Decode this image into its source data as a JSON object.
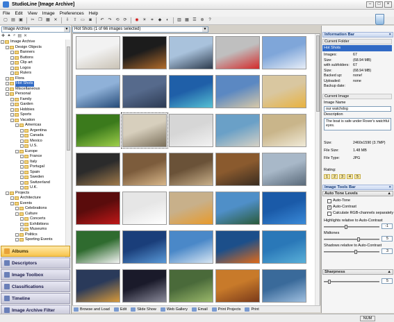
{
  "window": {
    "title": "StudioLine [Image Archive]"
  },
  "menu": [
    "File",
    "Edit",
    "View",
    "Image",
    "Preferences",
    "Help"
  ],
  "left": {
    "combo_value": "Image Archive",
    "tree": [
      {
        "label": "Image Archive",
        "indent": 0
      },
      {
        "label": "Design Objects",
        "indent": 1
      },
      {
        "label": "Banners",
        "indent": 2
      },
      {
        "label": "Buttons",
        "indent": 2
      },
      {
        "label": "Clip art",
        "indent": 2
      },
      {
        "label": "Logos",
        "indent": 2
      },
      {
        "label": "Rulers",
        "indent": 2
      },
      {
        "label": "Flora",
        "indent": 1
      },
      {
        "label": "Hot Shots",
        "indent": 1,
        "selected": true
      },
      {
        "label": "Miscellaneous",
        "indent": 1
      },
      {
        "label": "Personal",
        "indent": 1
      },
      {
        "label": "Family",
        "indent": 2
      },
      {
        "label": "Garden",
        "indent": 2
      },
      {
        "label": "Hobbies",
        "indent": 2
      },
      {
        "label": "Sports",
        "indent": 2
      },
      {
        "label": "Vacation",
        "indent": 2
      },
      {
        "label": "Americas",
        "indent": 3
      },
      {
        "label": "Argentina",
        "indent": 4
      },
      {
        "label": "Canada",
        "indent": 4
      },
      {
        "label": "Mexico",
        "indent": 4
      },
      {
        "label": "U.S.",
        "indent": 4
      },
      {
        "label": "Europe",
        "indent": 3
      },
      {
        "label": "France",
        "indent": 4
      },
      {
        "label": "Italy",
        "indent": 4
      },
      {
        "label": "Portugal",
        "indent": 4
      },
      {
        "label": "Spain",
        "indent": 4
      },
      {
        "label": "Sweden",
        "indent": 4
      },
      {
        "label": "Switzerland",
        "indent": 4
      },
      {
        "label": "U.K.",
        "indent": 4
      },
      {
        "label": "Projects",
        "indent": 1
      },
      {
        "label": "Architecture",
        "indent": 2
      },
      {
        "label": "Events",
        "indent": 2
      },
      {
        "label": "Celebrations",
        "indent": 3
      },
      {
        "label": "Culture",
        "indent": 3
      },
      {
        "label": "Concerts",
        "indent": 4
      },
      {
        "label": "Exhibitions",
        "indent": 4
      },
      {
        "label": "Museums",
        "indent": 4
      },
      {
        "label": "Politics",
        "indent": 3
      },
      {
        "label": "Sporting Events",
        "indent": 3
      }
    ],
    "panels": [
      "Albums",
      "Descriptors",
      "Image Toolbox",
      "Classifications",
      "Timeline",
      "Image Archive Filter"
    ]
  },
  "center": {
    "combo_value": "Hot Shots (1 of 66 images selected)",
    "thumbnails": [
      {
        "c1": "#f2f2f2",
        "c2": "#c9c2b5"
      },
      {
        "c1": "#1c1c1c",
        "c2": "#b26b2a"
      },
      {
        "c1": "#a9c2dc",
        "c2": "#2d3b4d"
      },
      {
        "c1": "#bfbfbf",
        "c2": "#d42a2a"
      },
      {
        "c1": "#7fa6d9",
        "c2": "#e8eef8"
      },
      {
        "c1": "#8fb1d8",
        "c2": "#264b78"
      },
      {
        "c1": "#566a8c",
        "c2": "#2c3a52"
      },
      {
        "c1": "#1f5fa8",
        "c2": "#56c1d3"
      },
      {
        "c1": "#5b88c2",
        "c2": "#d8c9a8"
      },
      {
        "c1": "#d9c7a0",
        "c2": "#e8b23f"
      },
      {
        "c1": "#3b7a1c",
        "c2": "#9fcf4a"
      },
      {
        "c1": "#d7cfbd",
        "c2": "#7a6f5a"
      },
      {
        "c1": "#d6d6d6",
        "c2": "#f2f2f2"
      },
      {
        "c1": "#6aa0c7",
        "c2": "#d6d1c5"
      },
      {
        "c1": "#c9b58a",
        "c2": "#f0ead8"
      },
      {
        "c1": "#2b2b2b",
        "c2": "#a07a4a"
      },
      {
        "c1": "#7c5c3c",
        "c2": "#d8b78a"
      },
      {
        "c1": "#6a5238",
        "c2": "#c9b08a"
      },
      {
        "c1": "#8a5a2e",
        "c2": "#3a2c20"
      },
      {
        "c1": "#a8b8c8",
        "c2": "#5a6a7a"
      },
      {
        "c1": "#5a0c0c",
        "c2": "#c01818"
      },
      {
        "c1": "#e6e6e6",
        "c2": "#ffffff"
      },
      {
        "c1": "#c8b08a",
        "c2": "#e89a2a"
      },
      {
        "c1": "#4f8fc8",
        "c2": "#2a5a3a"
      },
      {
        "c1": "#1a5aa8",
        "c2": "#3a8ad8"
      },
      {
        "c1": "#2f6b2f",
        "c2": "#f4f4f4"
      },
      {
        "c1": "#1a3e7a",
        "c2": "#5a9ad8"
      },
      {
        "c1": "#4a88c8",
        "c2": "#d8e6f2"
      },
      {
        "c1": "#1c4f8a",
        "c2": "#e06a1a"
      },
      {
        "c1": "#2a78b8",
        "c2": "#5ab0d8"
      },
      {
        "c1": "#2a3a5a",
        "c2": "#d89a3a"
      },
      {
        "c1": "#1a1a2a",
        "c2": "#8a8a9a"
      },
      {
        "c1": "#4a6a3a",
        "c2": "#9ab86a"
      },
      {
        "c1": "#c87a2a",
        "c2": "#7a3a1a"
      },
      {
        "c1": "#3a6a9a",
        "c2": "#a0c0e0"
      }
    ],
    "selected_index": 11,
    "bottom_buttons": [
      "Browse and Load",
      "Edit",
      "Slide Show",
      "Web Gallery",
      "Email",
      "Print Projects",
      "Print"
    ]
  },
  "right": {
    "info_bar_title": "Information Bar",
    "current_folder_label": "Current Folder",
    "current_folder_value": "Hot Shots",
    "folder_stats": [
      {
        "k": "Images:",
        "v": "67"
      },
      {
        "k": "  Size:",
        "v": "(68.94 MB)"
      },
      {
        "k": "with subfolders:",
        "v": "67"
      },
      {
        "k": "  Size:",
        "v": "(68.94 MB)"
      },
      {
        "k": "Backed up:",
        "v": "none!"
      },
      {
        "k": "Uploaded:",
        "v": "none"
      },
      {
        "k": "Backup date:",
        "v": ""
      }
    ],
    "current_image_label": "Current Image",
    "image_name_label": "Image Name",
    "image_name_value": "our watchdog",
    "description_label": "Description",
    "description_value": "The boat is safe under Rover's watchful eyes.",
    "image_stats": [
      {
        "k": "Size:",
        "v": "2460x1590 (3.7MP)"
      },
      {
        "k": "File Size:",
        "v": "1.48 MB"
      },
      {
        "k": "File Type:",
        "v": "JPG"
      }
    ],
    "rating_label": "Rating:",
    "rating": [
      "1",
      "2",
      "3",
      "4",
      "5"
    ],
    "toolsbar_title": "Image Tools Bar",
    "auto_tone_title": "Auto Tone Levels",
    "checks": [
      {
        "label": "Auto-Tone",
        "checked": false
      },
      {
        "label": "Auto-Contrast",
        "checked": true
      },
      {
        "label": "Calculate RGB-channels separately",
        "checked": false
      }
    ],
    "highlights_label": "Highlights relative to Auto-Contrast",
    "highlights_value": "-1",
    "midtones_label": "Midtones",
    "midtones_value": "5",
    "shadows_label": "Shadows relative to Auto-Contrast",
    "shadows_value": "3",
    "sharpness_title": "Sharpness",
    "sharpness_value": "5"
  },
  "status": {
    "num": "NUM"
  }
}
